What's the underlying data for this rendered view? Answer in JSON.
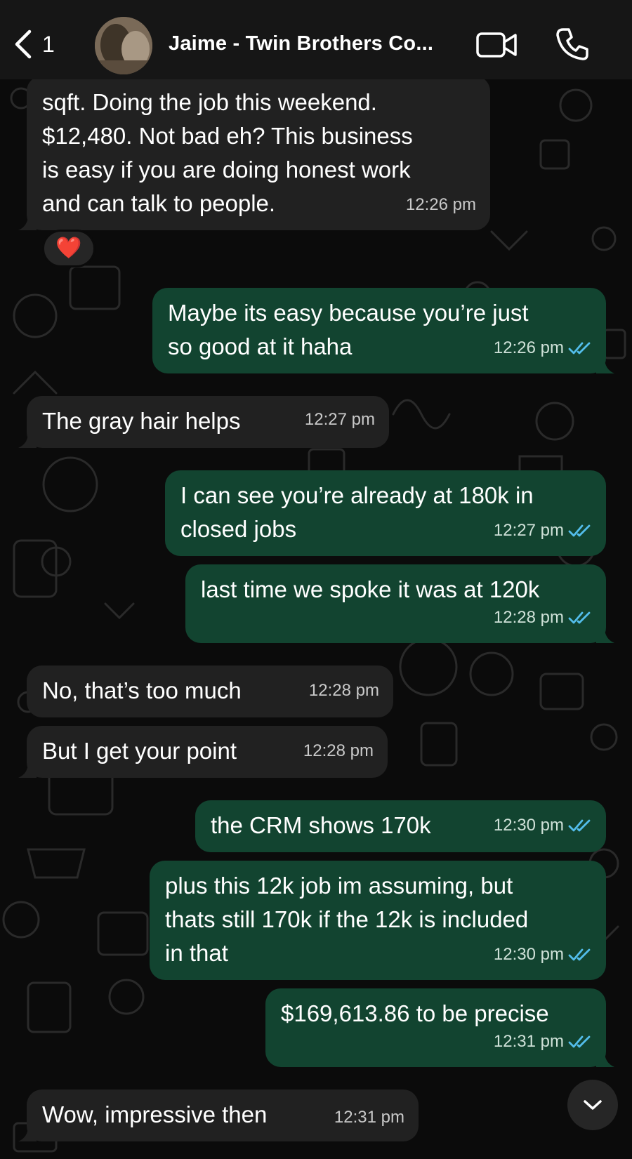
{
  "header": {
    "back_count": "1",
    "contact_name": "Jaime - Twin Brothers Co...",
    "icons": [
      "chevron-left-icon",
      "avatar",
      "video-camera-icon",
      "phone-icon"
    ]
  },
  "colors": {
    "incoming_bubble": "#212121",
    "outgoing_bubble": "#124430",
    "read_ticks": "#53bdeb",
    "background": "#0b0b0b",
    "header": "#161616"
  },
  "messages": [
    {
      "direction": "in",
      "text": "sqft. Doing the job this weekend.\n$12,480. Not bad eh? This business\nis easy if you are doing honest work\nand can talk to people.",
      "time": "12:26 pm"
    },
    {
      "direction": "out",
      "text": "Maybe its easy because you’re just\nso good at it haha",
      "time": "12:26 pm",
      "status": "read"
    },
    {
      "direction": "in",
      "text": "The gray hair helps",
      "time": "12:27 pm"
    },
    {
      "direction": "out",
      "text": "I can see you’re already at 180k in\nclosed jobs",
      "time": "12:27 pm",
      "status": "read"
    },
    {
      "direction": "out",
      "text": "last time we spoke it was at 120k",
      "time": "12:28 pm",
      "status": "read"
    },
    {
      "direction": "in",
      "text": "No, that’s too much",
      "time": "12:28 pm"
    },
    {
      "direction": "in",
      "text": "But I get your point",
      "time": "12:28 pm"
    },
    {
      "direction": "out",
      "text": "the CRM shows 170k",
      "time": "12:30 pm",
      "status": "read"
    },
    {
      "direction": "out",
      "text": "plus this 12k job im assuming, but\nthats still 170k if the 12k is included\nin that",
      "time": "12:30 pm",
      "status": "read"
    },
    {
      "direction": "out",
      "text": "$169,613.86 to be precise",
      "time": "12:31 pm",
      "status": "read"
    },
    {
      "direction": "in",
      "text": "Wow, impressive then",
      "time": "12:31 pm"
    }
  ],
  "reaction": {
    "emoji": "❤️",
    "message_index": 0
  },
  "scroll_button": {
    "icon": "chevron-down-icon"
  }
}
